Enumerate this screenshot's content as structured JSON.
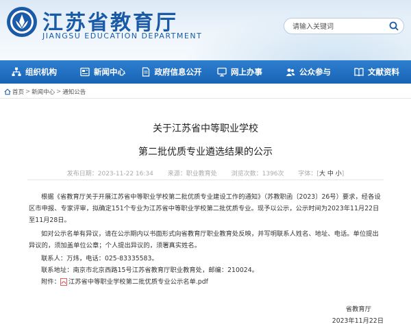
{
  "header": {
    "title": "江苏省教育厅",
    "subtitle": "JIANGSU EDUCATION DEPARTMENT",
    "search_placeholder": "请输入关键词"
  },
  "nav": [
    {
      "label": "组织机构",
      "icon": "org-chart-icon"
    },
    {
      "label": "新闻中心",
      "icon": "news-icon"
    },
    {
      "label": "政府信息公开",
      "icon": "document-icon"
    },
    {
      "label": "网上办事",
      "icon": "monitor-icon"
    },
    {
      "label": "公众参与",
      "icon": "people-icon"
    },
    {
      "label": "文献资料",
      "icon": "book-icon"
    }
  ],
  "breadcrumb": {
    "home": "首页",
    "sep": ">",
    "level1": "新闻中心",
    "level2": "通知公告"
  },
  "article": {
    "title_line1": "关于江苏省中等职业学校",
    "title_line2": "第二批优质专业遴选结果的公示",
    "date": "发布日期：2023-11-22 16:34",
    "source": "来源：职业教育处",
    "views": "浏览次数：1396次",
    "font_label": "字体：[",
    "font_big": "大",
    "font_mid": "中",
    "font_small": "小",
    "font_close": "]",
    "p1": "根据《省教育厅关于开展江苏省中等职业学校第二批优质专业建设工作的通知》（苏教职函〔2023〕26号）要求，经各设区市申报、专家评审，拟确定151个专业为江苏省中等职业学校第二批优质专业。现予以公示，公示时间为2023年11月22日至11月28日。",
    "p2": "如对公示名单有异议，请在公示期内以书面形式向省教育厅职业教育处反映，并写明联系人姓名、地址、电话。单位提出异议的，须加盖单位公章；个人提出异议的，须署真实姓名。",
    "contact": "联系人：万炜，电话：025-83335583。",
    "address": "联系地址：南京市北京西路15号江苏省教育厅职业教育处，邮编：210024。",
    "attachment_label": "附件：",
    "attachment_file": "江苏省中等职业学校第二批优质专业公示名单.pdf",
    "sign_org": "省教育厅",
    "sign_date": "2023年11月22日"
  },
  "colors": {
    "brand": "#1a5aa6",
    "nav": "#1f6dbf"
  }
}
